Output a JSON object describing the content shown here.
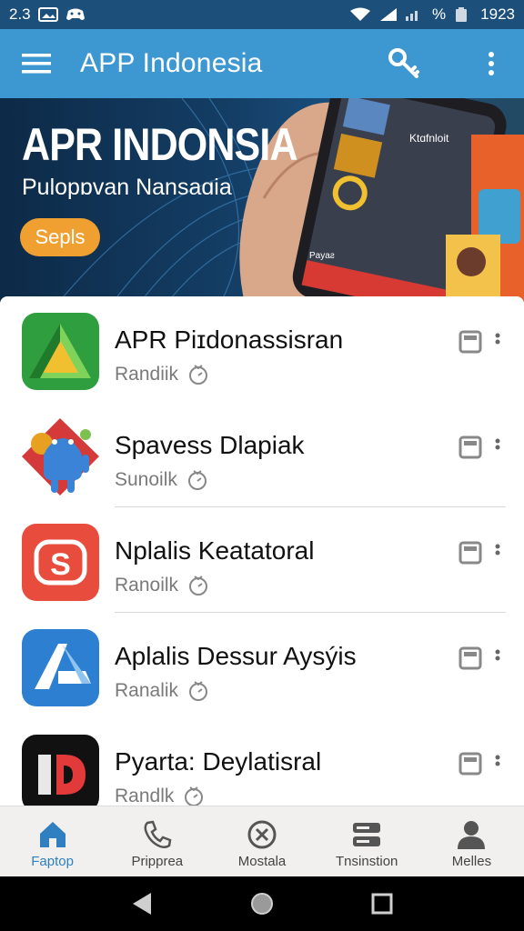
{
  "status_bar": {
    "left_time": "2.3",
    "battery_percent_icon": "%",
    "right_time": "1923",
    "icons": [
      "image-icon",
      "gamepad-icon",
      "wifi-icon",
      "signal-icon",
      "signal-bars-icon",
      "battery-icon"
    ]
  },
  "app_bar": {
    "title": "APP Indonesia",
    "icons": [
      "menu-icon",
      "key-icon",
      "more-vert-icon"
    ],
    "color": "#3d97d1"
  },
  "banner": {
    "title": "APR INDONSIA",
    "subtitle": "Pulopɒvan Nansaɑia",
    "button_label": "Sepls",
    "button_color": "#f0a030",
    "phone_labels": [
      "Ktɑfnloit",
      "Payaƨ"
    ]
  },
  "apps": [
    {
      "name": "APR Piɪdonassisran",
      "sub": "Randiik",
      "icon": "green-triangle-icon",
      "color": "#2e9e3e"
    },
    {
      "name": "Spavess Dlapiak",
      "sub": "Sunoilk",
      "icon": "android-robot-icon",
      "color": "#3a83d6"
    },
    {
      "name": "Nplalis Keatatoral",
      "sub": "Ranoilk",
      "icon": "s-logo-icon",
      "color": "#e84c3d"
    },
    {
      "name": "Aplalis Dessur Aysýis",
      "sub": "Ranalik",
      "icon": "a-logo-icon",
      "color": "#2d7fd1"
    },
    {
      "name": "Pyarta: Deylatisral",
      "sub": "Randlk",
      "icon": "d-logo-icon",
      "color": "#111111"
    }
  ],
  "bottom_nav": [
    {
      "label": "Faptop",
      "icon": "home-icon",
      "active": true
    },
    {
      "label": "Pripprea",
      "icon": "phone-icon",
      "active": false
    },
    {
      "label": "Mostala",
      "icon": "close-circle-icon",
      "active": false
    },
    {
      "label": "Tnsinstion",
      "icon": "storage-icon",
      "active": false
    },
    {
      "label": "Melles",
      "icon": "person-icon",
      "active": false
    }
  ],
  "system_nav": [
    "back-icon",
    "home-circle-icon",
    "recents-icon"
  ]
}
